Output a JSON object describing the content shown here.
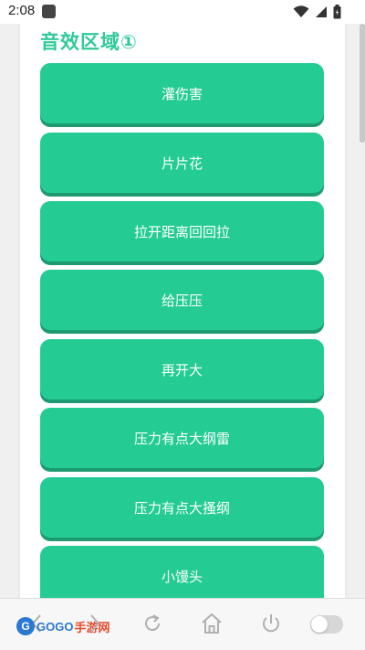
{
  "status_bar": {
    "time": "2:08",
    "icons": [
      "wifi-icon",
      "signal-icon",
      "battery-icon"
    ]
  },
  "section": {
    "title": "音效区域①"
  },
  "buttons": [
    {
      "label": "灌伤害"
    },
    {
      "label": "片片花"
    },
    {
      "label": "拉开距离回回拉"
    },
    {
      "label": "给压压"
    },
    {
      "label": "再开大"
    },
    {
      "label": "压力有点大纲雷"
    },
    {
      "label": "压力有点大搔纲"
    },
    {
      "label": "小馒头"
    }
  ],
  "bottom_bar": {
    "watermark": {
      "logo_text": "G",
      "brand": "GOGO",
      "suffix": "手游网"
    },
    "icons": [
      "back-icon",
      "forward-icon",
      "refresh-icon",
      "home-icon",
      "power-icon",
      "toggle-switch"
    ]
  },
  "colors": {
    "accent": "#24cc93",
    "accent_shadow": "#1d9a70",
    "title": "#2ecb94"
  }
}
